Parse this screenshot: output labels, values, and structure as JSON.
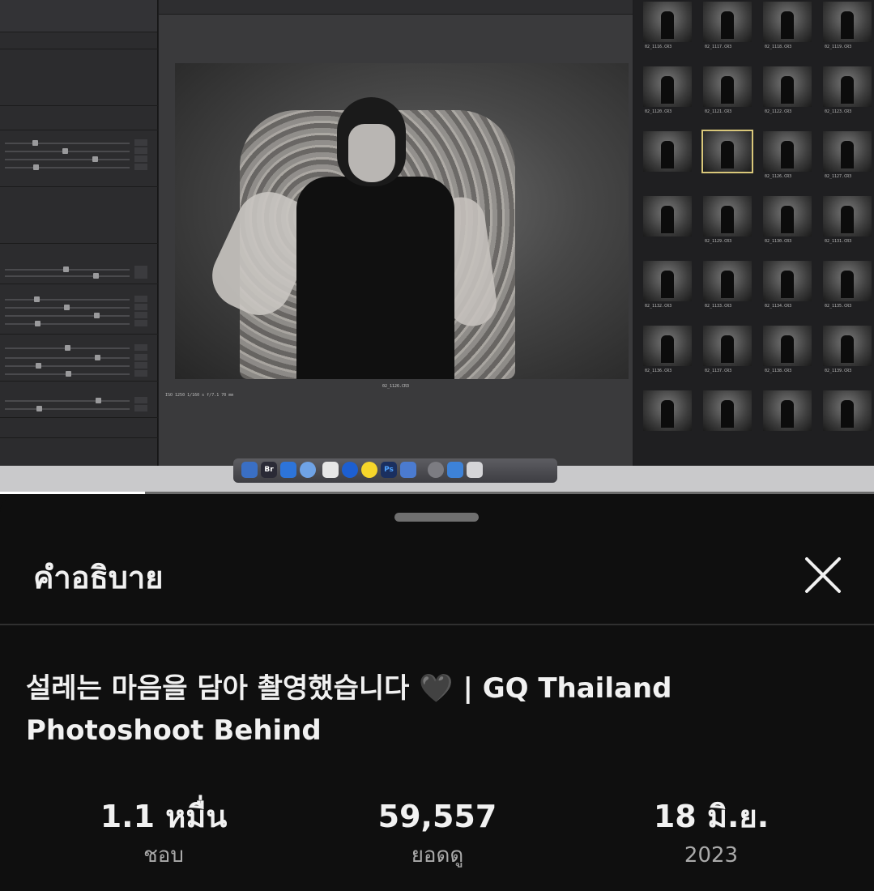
{
  "video": {
    "progress_fraction": 0.166,
    "photo_caption": "02_1126.CR3",
    "photo_meta": "ISO 1250    1/160 s    f/7.1    70 mm",
    "thumbnails": [
      "02_1116.CR3",
      "02_1117.CR3",
      "02_1118.CR3",
      "02_1119.CR3",
      "02_1120.CR3",
      "02_1121.CR3",
      "02_1122.CR3",
      "02_1123.CR3",
      "",
      "",
      "02_1126.CR3",
      "02_1127.CR3",
      "",
      "02_1129.CR3",
      "02_1130.CR3",
      "02_1131.CR3",
      "02_1132.CR3",
      "02_1133.CR3",
      "02_1134.CR3",
      "02_1135.CR3",
      "02_1136.CR3",
      "02_1137.CR3",
      "02_1138.CR3",
      "02_1139.CR3",
      "",
      "",
      "",
      ""
    ],
    "dock_apps": [
      "Br",
      "Ps"
    ]
  },
  "sheet": {
    "header_title": "คำอธิบาย",
    "close_icon": "close-icon",
    "video_title": "설레는 마음을 담아 촬영했습니다 🖤 | GQ Thailand Photoshoot Behind",
    "stats": [
      {
        "value": "1.1 หมื่น",
        "label": "ชอบ"
      },
      {
        "value": "59,557",
        "label": "ยอดดู"
      },
      {
        "value": "18 มิ.ย.",
        "label": "2023"
      }
    ]
  }
}
